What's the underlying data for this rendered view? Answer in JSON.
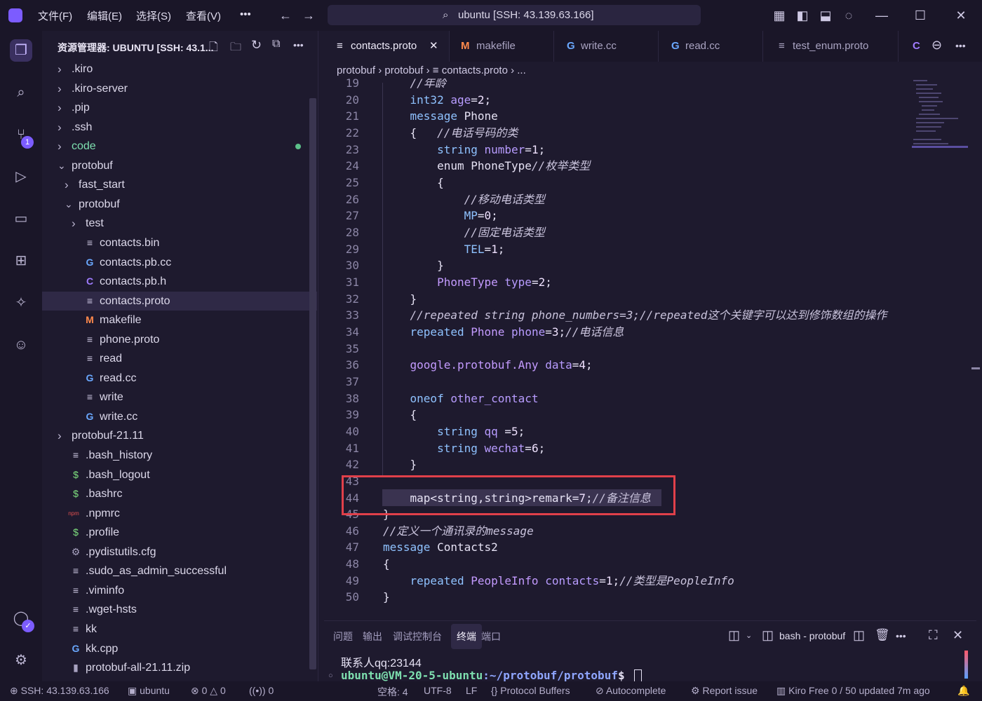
{
  "titlebar": {
    "menus": [
      "文件(F)",
      "编辑(E)",
      "选择(S)",
      "查看(V)",
      "•••"
    ],
    "search": "ubuntu [SSH: 43.139.63.166]"
  },
  "activity": {
    "scm_badge": "1"
  },
  "sidebar": {
    "header": "资源管理器: UBUNTU [SSH: 43.1...",
    "items": [
      {
        "label": ".kiro",
        "kind": "folder",
        "open": false,
        "depth": 0
      },
      {
        "label": ".kiro-server",
        "kind": "folder",
        "open": false,
        "depth": 0
      },
      {
        "label": ".pip",
        "kind": "folder",
        "open": false,
        "depth": 0
      },
      {
        "label": ".ssh",
        "kind": "folder",
        "open": false,
        "depth": 0
      },
      {
        "label": "code",
        "kind": "folder",
        "open": false,
        "depth": 0,
        "color": "#7ee0b0"
      },
      {
        "label": "protobuf",
        "kind": "folder",
        "open": true,
        "depth": 0
      },
      {
        "label": "fast_start",
        "kind": "folder",
        "open": false,
        "depth": 1
      },
      {
        "label": "protobuf",
        "kind": "folder",
        "open": true,
        "depth": 1
      },
      {
        "label": "test",
        "kind": "folder",
        "open": false,
        "depth": 2
      },
      {
        "label": "contacts.bin",
        "kind": "lines",
        "depth": 2
      },
      {
        "label": "contacts.pb.cc",
        "kind": "cpp",
        "depth": 2
      },
      {
        "label": "contacts.pb.h",
        "kind": "c",
        "depth": 2
      },
      {
        "label": "contacts.proto",
        "kind": "lines",
        "depth": 2,
        "selected": true
      },
      {
        "label": "makefile",
        "kind": "make",
        "depth": 2
      },
      {
        "label": "phone.proto",
        "kind": "lines",
        "depth": 2
      },
      {
        "label": "read",
        "kind": "lines",
        "depth": 2
      },
      {
        "label": "read.cc",
        "kind": "cpp",
        "depth": 2
      },
      {
        "label": "write",
        "kind": "lines",
        "depth": 2
      },
      {
        "label": "write.cc",
        "kind": "cpp",
        "depth": 2
      },
      {
        "label": "protobuf-21.11",
        "kind": "folder",
        "open": false,
        "depth": 0
      },
      {
        "label": ".bash_history",
        "kind": "lines",
        "depth": 0
      },
      {
        "label": ".bash_logout",
        "kind": "shell",
        "depth": 0
      },
      {
        "label": ".bashrc",
        "kind": "shell",
        "depth": 0
      },
      {
        "label": ".npmrc",
        "kind": "npm",
        "depth": 0
      },
      {
        "label": ".profile",
        "kind": "shell",
        "depth": 0
      },
      {
        "label": ".pydistutils.cfg",
        "kind": "gear",
        "depth": 0
      },
      {
        "label": ".sudo_as_admin_successful",
        "kind": "lines",
        "depth": 0
      },
      {
        "label": ".viminfo",
        "kind": "lines",
        "depth": 0
      },
      {
        "label": ".wget-hsts",
        "kind": "lines",
        "depth": 0
      },
      {
        "label": "kk",
        "kind": "lines",
        "depth": 0
      },
      {
        "label": "kk.cpp",
        "kind": "cpp",
        "depth": 0
      },
      {
        "label": "protobuf-all-21.11.zip",
        "kind": "zip",
        "depth": 0
      }
    ]
  },
  "tabs": [
    {
      "label": "contacts.proto",
      "icon": "≡",
      "active": true
    },
    {
      "label": "makefile",
      "icon": "M"
    },
    {
      "label": "write.cc",
      "icon": "G"
    },
    {
      "label": "read.cc",
      "icon": "G"
    },
    {
      "label": "test_enum.proto",
      "icon": "≡"
    },
    {
      "label": "C",
      "icon": ""
    }
  ],
  "breadcrumb": [
    "protobuf",
    "protobuf",
    "contacts.proto",
    "..."
  ],
  "code_lines": [
    {
      "n": "19",
      "html": "    <span class='c'>//年龄</span>"
    },
    {
      "n": "20",
      "html": "    <span class='k'>int32</span> <span class='n'>age</span>=<span class='num'>2</span>;"
    },
    {
      "n": "21",
      "html": "    <span class='k'>message</span> Phone"
    },
    {
      "n": "22",
      "html": "    {   <span class='c'>//电话号码的类</span>"
    },
    {
      "n": "23",
      "html": "        <span class='k'>string</span> <span class='n'>number</span>=<span class='num'>1</span>;"
    },
    {
      "n": "24",
      "html": "        enum PhoneType<span class='c'>//枚举类型</span>"
    },
    {
      "n": "25",
      "html": "        {"
    },
    {
      "n": "26",
      "html": "            <span class='c'>//移动电话类型</span>"
    },
    {
      "n": "27",
      "html": "            <span class='k'>MP</span>=<span class='num'>0</span>;"
    },
    {
      "n": "28",
      "html": "            <span class='c'>//固定电话类型</span>"
    },
    {
      "n": "29",
      "html": "            <span class='k'>TEL</span>=<span class='num'>1</span>;"
    },
    {
      "n": "30",
      "html": "        }"
    },
    {
      "n": "31",
      "html": "        <span class='t'>PhoneType</span> <span class='n'>type</span>=<span class='num'>2</span>;"
    },
    {
      "n": "32",
      "html": "    }"
    },
    {
      "n": "33",
      "html": "    <span class='c'>//repeated string phone_numbers=3;//repeated这个关键字可以达到修饰数组的操作</span>"
    },
    {
      "n": "34",
      "html": "    <span class='k'>repeated</span> <span class='t'>Phone</span> <span class='n'>phone</span>=<span class='num'>3</span>;<span class='c'>//电话信息</span>"
    },
    {
      "n": "35",
      "html": ""
    },
    {
      "n": "36",
      "html": "    <span class='t'>google.protobuf.Any</span> <span class='n'>data</span>=<span class='num'>4</span>;"
    },
    {
      "n": "37",
      "html": ""
    },
    {
      "n": "38",
      "html": "    <span class='k'>oneof</span> <span class='n'>other_contact</span>"
    },
    {
      "n": "39",
      "html": "    {"
    },
    {
      "n": "40",
      "html": "        <span class='k'>string</span> <span class='n'>qq</span> =<span class='num'>5</span>;"
    },
    {
      "n": "41",
      "html": "        <span class='k'>string</span> <span class='n'>wechat</span>=<span class='num'>6</span>;"
    },
    {
      "n": "42",
      "html": "    }"
    },
    {
      "n": "43",
      "html": ""
    },
    {
      "n": "44",
      "html": "    map&lt;string,string&gt;remark=<span class='num'>7</span>;<span class='c'>//备注信息</span>"
    },
    {
      "n": "45",
      "html": "}"
    },
    {
      "n": "46",
      "html": "<span class='c'>//定义一个通讯录的message</span>"
    },
    {
      "n": "47",
      "html": "<span class='k'>message</span> Contacts2"
    },
    {
      "n": "48",
      "html": "{"
    },
    {
      "n": "49",
      "html": "    <span class='k'>repeated</span> <span class='t'>PeopleInfo</span> <span class='n'>contacts</span>=<span class='num'>1</span>;<span class='c'>//类型是PeopleInfo</span>"
    },
    {
      "n": "50",
      "html": "}"
    }
  ],
  "panel": {
    "tabs": [
      "问题",
      "输出",
      "调试控制台",
      "终端",
      "端口"
    ],
    "active_tab": "终端",
    "terminal_name": "bash - protobuf",
    "line1": "联系人qq:23144",
    "prompt_user": "ubuntu@VM-20-5-ubuntu",
    "prompt_path": ":~/protobuf/protobuf",
    "prompt_end": "$"
  },
  "status": {
    "ssh": "SSH: 43.139.63.166",
    "ubuntu": "ubuntu",
    "errors": "0",
    "warnings": "0",
    "ports": "0",
    "spaces": "空格: 4",
    "encoding": "UTF-8",
    "eol": "LF",
    "language": "Protocol Buffers",
    "autocomplete": "Autocomplete",
    "report": "Report issue",
    "kiro": "Kiro Free 0 / 50 updated 7m ago"
  },
  "colors": {
    "accent": "#7c5cff",
    "highlight_box": "#e0404a",
    "prompt_user": "#7ee0b0",
    "prompt_path": "#8fa6ff"
  }
}
